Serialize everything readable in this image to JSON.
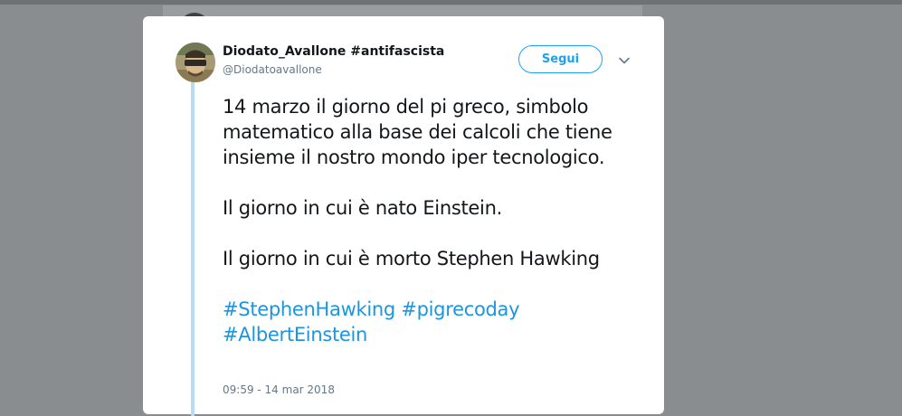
{
  "colors": {
    "overlay": "#8a8d90",
    "card": "#ffffff",
    "accent": "#1da1f2",
    "link": "#1b95e0",
    "thread_line": "#b6dbf3",
    "text": "#14171a",
    "muted": "#657786"
  },
  "tweet": {
    "author": {
      "display_name": "Diodato_Avallone #antifascista",
      "handle": "@Diodatoavallone",
      "avatar_icon": "user-avatar"
    },
    "follow_label": "Segui",
    "menu_icon": "chevron-down-icon",
    "paragraphs": [
      "14 marzo il giorno del pi greco, simbolo matematico alla base dei calcoli che tiene insieme il nostro mondo iper tecnologico.",
      "Il giorno in cui è nato Einstein.",
      "Il giorno in cui è morto Stephen Hawking"
    ],
    "hashtags": [
      "#StephenHawking",
      "#pigrecoday",
      "#AlbertEinstein"
    ],
    "timestamp": "09:59 - 14 mar 2018"
  }
}
